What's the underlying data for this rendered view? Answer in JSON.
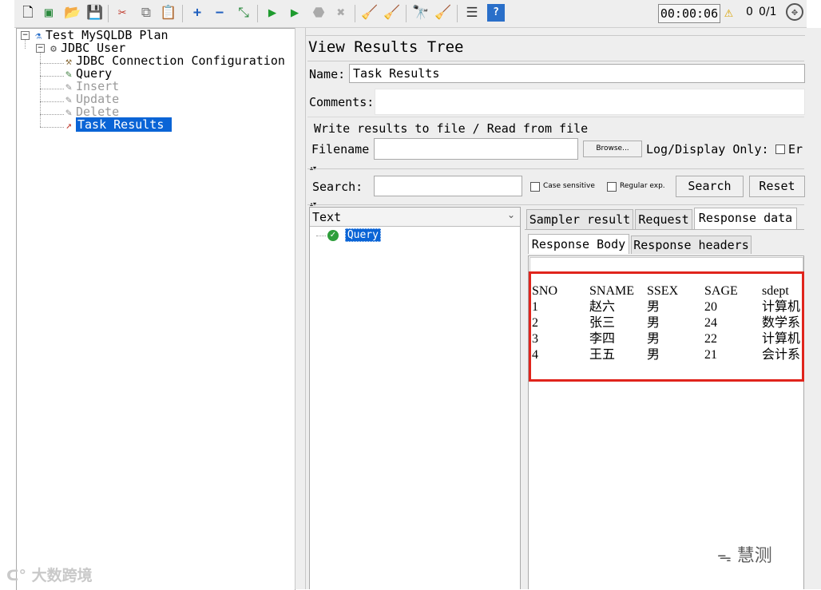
{
  "toolbar": {
    "timer": "00:00:06",
    "warning_count": "0",
    "thread_count": "0/1"
  },
  "tree": {
    "root": "Test MySQLDB Plan",
    "thread_group": "JDBC User",
    "items": [
      {
        "label": "JDBC Connection Configuration",
        "enabled": true
      },
      {
        "label": "Query",
        "enabled": true
      },
      {
        "label": "Insert",
        "enabled": false
      },
      {
        "label": "Update",
        "enabled": false
      },
      {
        "label": "Delete",
        "enabled": false
      },
      {
        "label": "Task Results",
        "enabled": true,
        "selected": true
      }
    ]
  },
  "panel": {
    "title": "View Results Tree",
    "name_label": "Name:",
    "name_value": "Task Results",
    "comments_label": "Comments:",
    "comments_value": "",
    "file_section_title": "Write results to file / Read from file",
    "filename_label": "Filename",
    "filename_value": "",
    "browse_button": "Browse...",
    "log_display_label": "Log/Display Only:",
    "errors_label": "Er"
  },
  "search": {
    "label": "Search:",
    "value": "",
    "case_sensitive_label": "Case sensitive",
    "regular_exp_label": "Regular exp.",
    "search_button": "Search",
    "reset_button": "Reset"
  },
  "results": {
    "renderer": "Text",
    "samples": [
      {
        "label": "Query",
        "status": "success"
      }
    ]
  },
  "detail_tabs": [
    "Sampler result",
    "Request",
    "Response data"
  ],
  "detail_active_tab": "Response data",
  "response_tabs": [
    "Response Body",
    "Response headers"
  ],
  "response_active_tab": "Response Body",
  "response_table": {
    "headers": [
      "SNO",
      "SNAME",
      "SSEX",
      "SAGE",
      "sdept"
    ],
    "rows": [
      [
        "1",
        "赵六",
        "男",
        "20",
        "计算机"
      ],
      [
        "2",
        "张三",
        "男",
        "24",
        "数学系"
      ],
      [
        "3",
        "李四",
        "男",
        "22",
        "计算机"
      ],
      [
        "4",
        "王五",
        "男",
        "21",
        "会计系"
      ]
    ]
  },
  "watermarks": {
    "left": "大数跨境",
    "right": "慧测"
  },
  "colors": {
    "selection": "#0a64d6",
    "highlight_box": "#e0241c",
    "success": "#2e9e3b",
    "warning": "#d9a200"
  }
}
